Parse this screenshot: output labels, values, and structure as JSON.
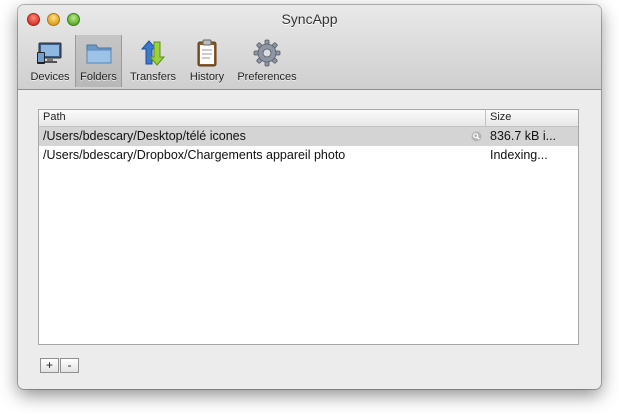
{
  "window": {
    "title": "SyncApp"
  },
  "toolbar": {
    "items": [
      {
        "label": "Devices",
        "icon": "devices-icon"
      },
      {
        "label": "Folders",
        "icon": "folder-icon",
        "selected": true
      },
      {
        "label": "Transfers",
        "icon": "transfer-arrows-icon"
      },
      {
        "label": "History",
        "icon": "clipboard-icon"
      },
      {
        "label": "Preferences",
        "icon": "gear-icon"
      }
    ]
  },
  "table": {
    "columns": [
      "Path",
      "Size"
    ],
    "rows": [
      {
        "path": "/Users/bdescary/Desktop/télé icones",
        "size": "836.7 kB i...",
        "selected": true
      },
      {
        "path": "/Users/bdescary/Dropbox/Chargements appareil photo",
        "size": "Indexing..."
      }
    ]
  },
  "buttons": {
    "add_label": "+",
    "remove_label": "-"
  },
  "colors": {
    "selected_row": "#d4d4d4",
    "close": "#d8362b",
    "minimize": "#e0a21c",
    "zoom": "#5fae2c"
  }
}
